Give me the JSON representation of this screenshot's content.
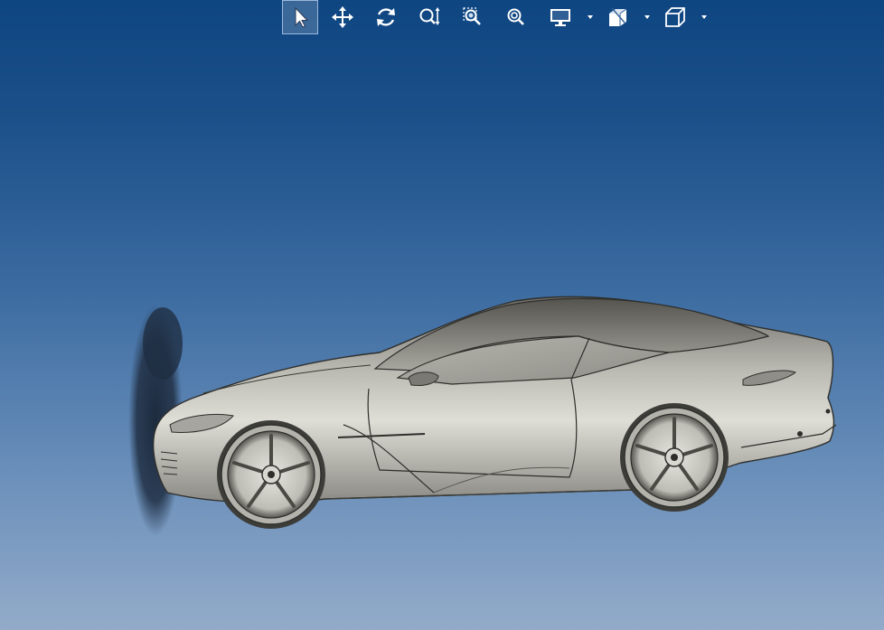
{
  "toolbar": {
    "buttons": [
      {
        "name": "select-tool",
        "icon": "cursor-arrow-icon",
        "active": true
      },
      {
        "name": "pan-tool",
        "icon": "pan-arrows-icon",
        "active": false
      },
      {
        "name": "rotate-tool",
        "icon": "rotate-icon",
        "active": false
      },
      {
        "name": "zoom-dynamic-tool",
        "icon": "zoom-vertical-icon",
        "active": false
      },
      {
        "name": "zoom-window-tool",
        "icon": "zoom-window-icon",
        "active": false
      },
      {
        "name": "zoom-fit-tool",
        "icon": "zoom-fit-icon",
        "active": false
      },
      {
        "name": "display-mode-dropdown",
        "icon": "monitor-icon",
        "active": false
      },
      {
        "name": "section-view-dropdown",
        "icon": "section-box-icon",
        "active": false
      },
      {
        "name": "view-orientation-dropdown",
        "icon": "cube-view-icon",
        "active": false
      }
    ]
  },
  "viewport": {
    "background_top": "#0e4682",
    "background_bottom": "#93abc9",
    "model": "sports-car-side-view"
  }
}
